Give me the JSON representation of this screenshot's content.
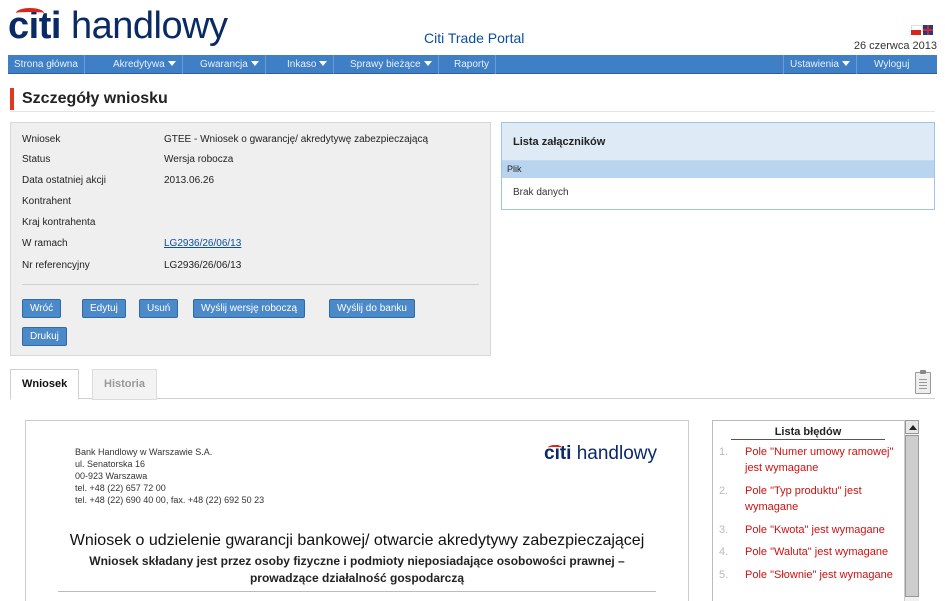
{
  "header": {
    "logo_mark": "citi",
    "logo_text": "handlowy",
    "portal_title": "Citi Trade Portal",
    "date": "26 czerwca 2013"
  },
  "nav": {
    "items": [
      {
        "label": "Strona główna",
        "has_dropdown": false
      },
      {
        "label": "Akredytywa",
        "has_dropdown": true
      },
      {
        "label": "Gwarancja",
        "has_dropdown": true
      },
      {
        "label": "Inkaso",
        "has_dropdown": true
      },
      {
        "label": "Sprawy bieżące",
        "has_dropdown": true
      },
      {
        "label": "Raporty",
        "has_dropdown": false
      }
    ],
    "right_items": [
      {
        "label": "Ustawienia",
        "has_dropdown": true
      },
      {
        "label": "Wyloguj",
        "has_dropdown": false
      }
    ]
  },
  "page_title": "Szczegóły wniosku",
  "details": {
    "rows": [
      {
        "label": "Wniosek",
        "value": "GTEE - Wniosek o gwarancję/ akredytywę zabezpieczającą"
      },
      {
        "label": "Status",
        "value": "Wersja robocza"
      },
      {
        "label": "Data ostatniej akcji",
        "value": "2013.06.26"
      },
      {
        "label": "Kontrahent",
        "value": ""
      },
      {
        "label": "Kraj kontrahenta",
        "value": ""
      },
      {
        "label": "W ramach",
        "value": "LG2936/26/06/13"
      },
      {
        "label": "Nr referencyjny",
        "value": "LG2936/26/06/13"
      }
    ],
    "buttons": [
      "Wróć",
      "Edytuj",
      "Usuń",
      "Wyślij wersję roboczą",
      "Wyślij do banku",
      "Drukuj"
    ]
  },
  "attachments": {
    "title": "Lista załączników",
    "column": "Plik",
    "empty_text": "Brak danych"
  },
  "tabs": [
    "Wniosek",
    "Historia"
  ],
  "document": {
    "address_lines": [
      "Bank Handlowy w Warszawie S.A.",
      "ul. Senatorska 16",
      "00-923 Warszawa",
      "tel. +48 (22) 657 72 00",
      "tel. +48 (22) 690 40 00, fax. +48 (22) 692 50 23"
    ],
    "logo_mark": "citi",
    "logo_text": "handlowy",
    "title": "Wniosek o udzielenie gwarancji bankowej/ otwarcie akredytywy zabezpieczającej",
    "subtitle": "Wniosek składany jest przez osoby fizyczne i podmioty nieposiadające osobowości prawnej – prowadzące działalność gospodarczą"
  },
  "errors": {
    "title": "Lista błędów",
    "items": [
      {
        "num": "1.",
        "msg": "Pole \"Numer umowy ramowej\" jest wymagane"
      },
      {
        "num": "2.",
        "msg": "Pole \"Typ produktu\" jest wymagane"
      },
      {
        "num": "3.",
        "msg": "Pole \"Kwota\" jest wymagane"
      },
      {
        "num": "4.",
        "msg": "Pole \"Waluta\" jest wymagane"
      },
      {
        "num": "5.",
        "msg": "Pole \"Słownie\" jest wymagane"
      }
    ]
  },
  "colors": {
    "nav_bg": "#3f7fc6",
    "button_bg": "#4b89c8",
    "accent_red": "#e2381f",
    "error_red": "#cc1111",
    "brand_navy": "#0a2a66"
  }
}
